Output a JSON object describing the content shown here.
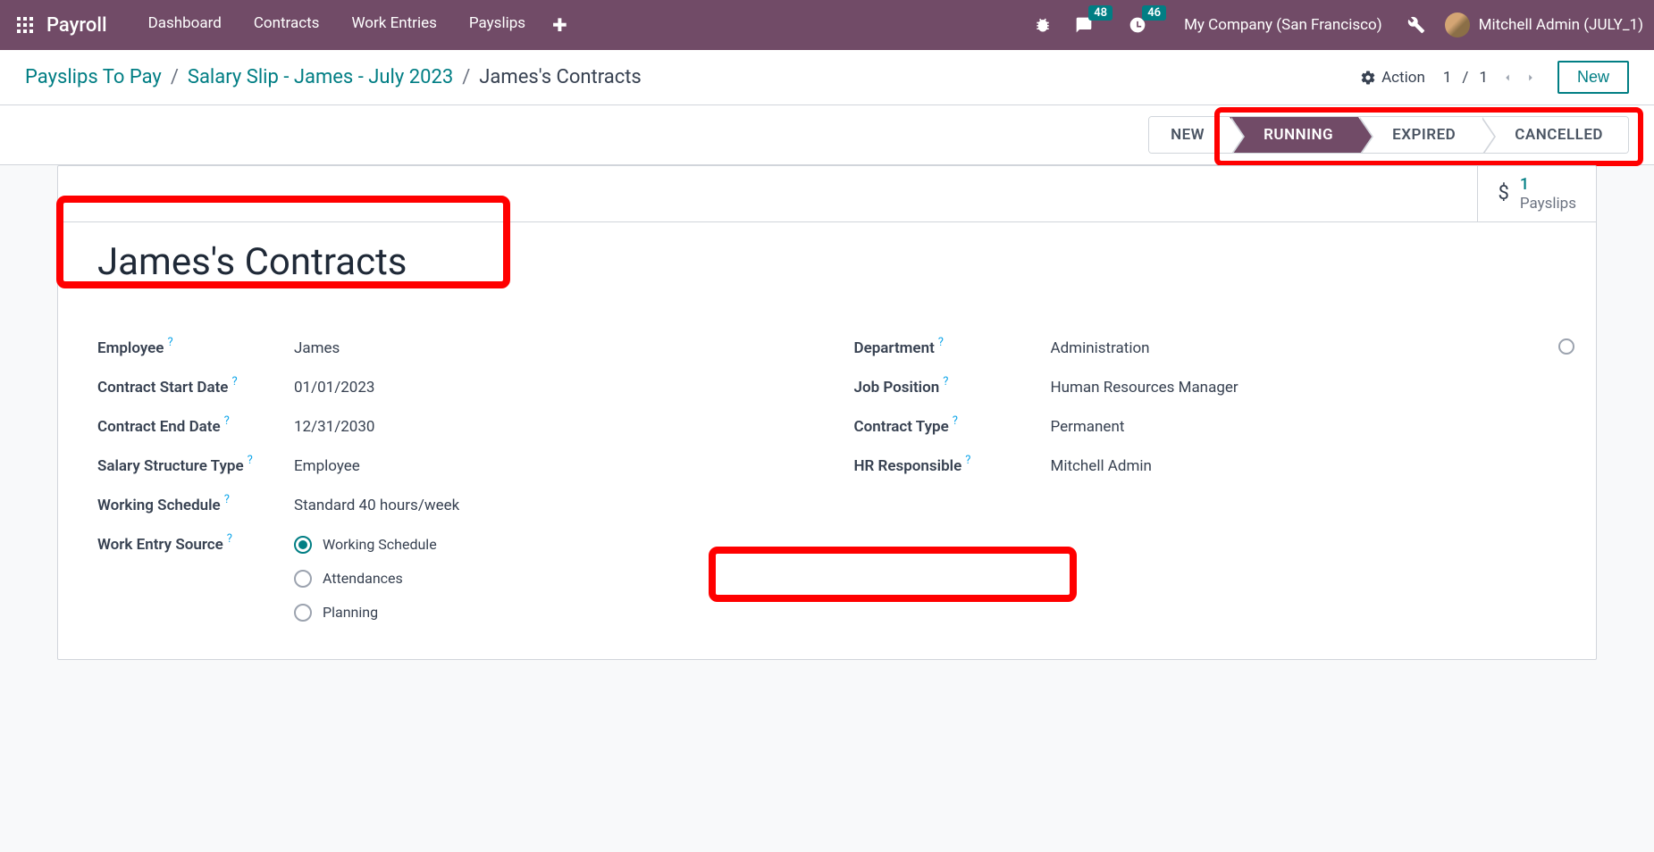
{
  "nav": {
    "brand": "Payroll",
    "links": [
      "Dashboard",
      "Contracts",
      "Work Entries",
      "Payslips"
    ],
    "messages_badge": "48",
    "activities_badge": "46",
    "company": "My Company (San Francisco)",
    "user": "Mitchell Admin (JULY_1)"
  },
  "breadcrumb": {
    "c1": "Payslips To Pay",
    "c2": "Salary Slip - James - July 2023",
    "c3": "James's Contracts"
  },
  "action_label": "Action",
  "pager": {
    "current": "1",
    "sep": "/",
    "total": "1"
  },
  "new_btn": "New",
  "status_steps": [
    "NEW",
    "RUNNING",
    "EXPIRED",
    "CANCELLED"
  ],
  "status_active_index": 1,
  "stat": {
    "count": "1",
    "label": "Payslips"
  },
  "title": "James's Contracts",
  "fields_left": {
    "employee_label": "Employee",
    "employee_value": "James",
    "start_label": "Contract Start Date",
    "start_value": "01/01/2023",
    "end_label": "Contract End Date",
    "end_value": "12/31/2030",
    "structure_label": "Salary Structure Type",
    "structure_value": "Employee",
    "schedule_label": "Working Schedule",
    "schedule_value": "Standard 40 hours/week",
    "source_label": "Work Entry Source",
    "source_options": [
      "Working Schedule",
      "Attendances",
      "Planning"
    ],
    "source_selected": 0
  },
  "fields_right": {
    "dept_label": "Department",
    "dept_value": "Administration",
    "job_label": "Job Position",
    "job_value": "Human Resources Manager",
    "ctype_label": "Contract Type",
    "ctype_value": "Permanent",
    "hr_label": "HR Responsible",
    "hr_value": "Mitchell Admin"
  },
  "help": "?"
}
